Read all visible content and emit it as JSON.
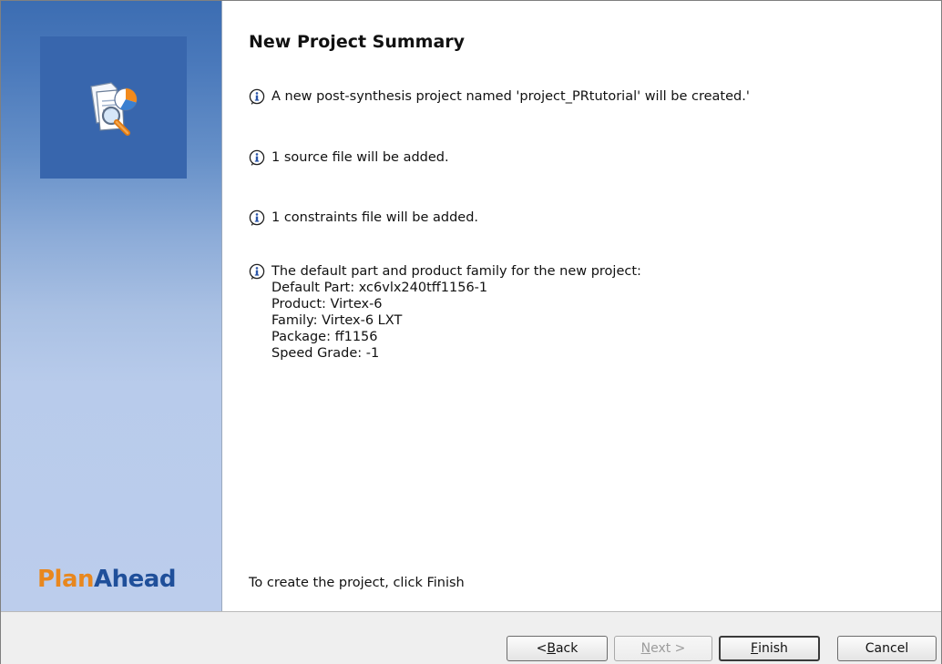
{
  "sidebar": {
    "brand_plan": "Plan",
    "brand_ahead": "Ahead",
    "logo_icon": "project-summary-magnifier-icon"
  },
  "main": {
    "title": "New Project Summary",
    "messages": [
      {
        "icon": "info-icon",
        "lines": [
          "A new post-synthesis project named 'project_PRtutorial' will be created.'"
        ]
      },
      {
        "icon": "info-icon",
        "lines": [
          "1 source file will be added."
        ]
      },
      {
        "icon": "info-icon",
        "lines": [
          "1 constraints file will be added."
        ]
      },
      {
        "icon": "info-icon",
        "lines": [
          "The default part and product family for the new project:",
          "Default Part: xc6vlx240tff1156-1",
          "Product: Virtex-6",
          "Family: Virtex-6 LXT",
          "Package: ff1156",
          "Speed Grade: -1"
        ]
      }
    ],
    "footer": "To create the project, click Finish"
  },
  "buttons": {
    "back": {
      "prefix": "< ",
      "mnemonic": "B",
      "rest": "ack",
      "enabled": true
    },
    "next": {
      "mnemonic": "N",
      "rest": "ext >",
      "enabled": false
    },
    "finish": {
      "mnemonic": "F",
      "rest": "inish",
      "enabled": true,
      "default": true
    },
    "cancel": {
      "label": "Cancel",
      "enabled": true
    }
  },
  "colors": {
    "brand_plan": "#e8871e",
    "brand_ahead": "#1f4f9a",
    "sidebar_top": "#3c6db2",
    "sidebar_bottom": "#bccdec"
  }
}
